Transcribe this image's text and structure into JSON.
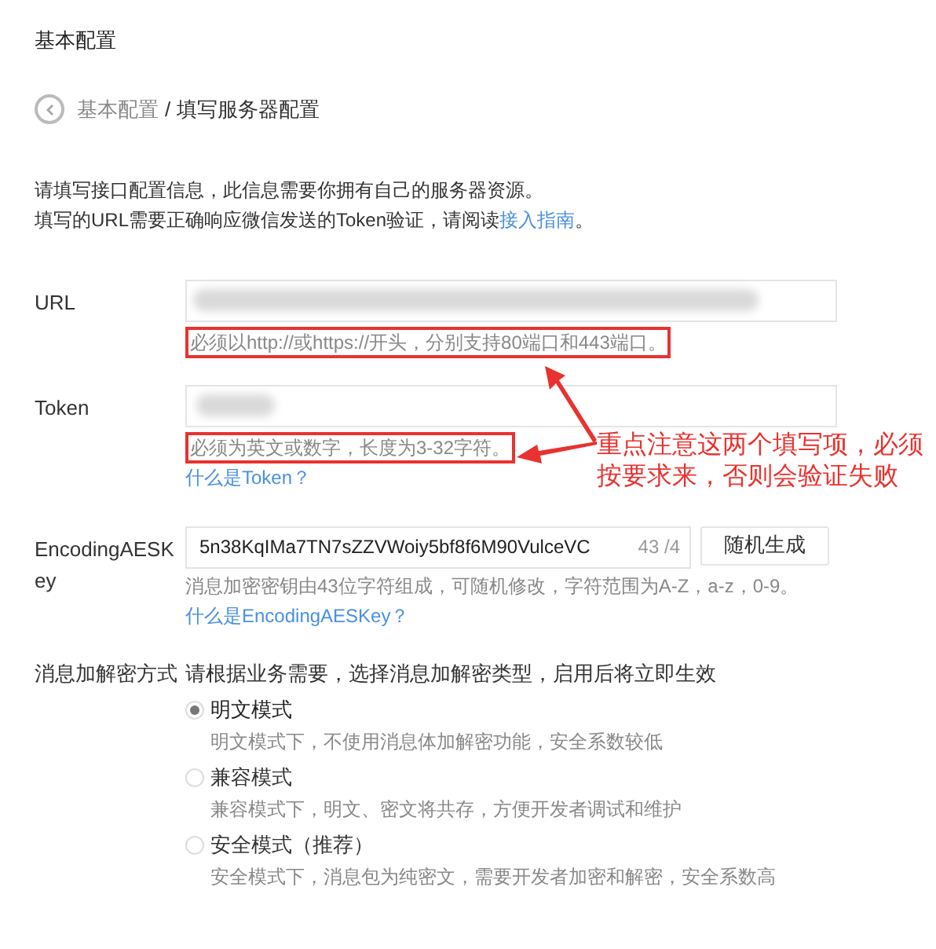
{
  "page_title": "基本配置",
  "breadcrumb": {
    "parent": "基本配置",
    "separator": "/",
    "current": "填写服务器配置"
  },
  "intro": {
    "line1": "请填写接口配置信息，此信息需要你拥有自己的服务器资源。",
    "line2": "填写的URL需要正确响应微信发送的Token验证，请阅读",
    "link": "接入指南",
    "suffix": "。"
  },
  "url": {
    "label": "URL",
    "hint": "必须以http://或https://开头，分别支持80端口和443端口。"
  },
  "token": {
    "label": "Token",
    "hint": "必须为英文或数字，长度为3-32字符。",
    "help_link": "什么是Token？"
  },
  "aes_key": {
    "label": "EncodingAESKey",
    "value": "5n38KqIMa7TN7sZZVWoiy5bf8f6M90VulceVC",
    "counter": "43 /4",
    "button": "随机生成",
    "hint": "消息加密密钥由43位字符组成，可随机修改，字符范围为A-Z，a-z，0-9。",
    "help_link": "什么是EncodingAESKey？"
  },
  "encryption": {
    "label": "消息加解密方式",
    "description": "请根据业务需要，选择消息加解密类型，启用后将立即生效",
    "options": [
      {
        "label": "明文模式",
        "description": "明文模式下，不使用消息体加解密功能，安全系数较低",
        "selected": true
      },
      {
        "label": "兼容模式",
        "description": "兼容模式下，明文、密文将共存，方便开发者调试和维护",
        "selected": false
      },
      {
        "label": "安全模式（推荐）",
        "description": "安全模式下，消息包为纯密文，需要开发者加密和解密，安全系数高",
        "selected": false
      }
    ]
  },
  "annotation": {
    "lines": [
      "重点注意这两个填写项，必须",
      "按要求来，否则会验证失败"
    ]
  }
}
